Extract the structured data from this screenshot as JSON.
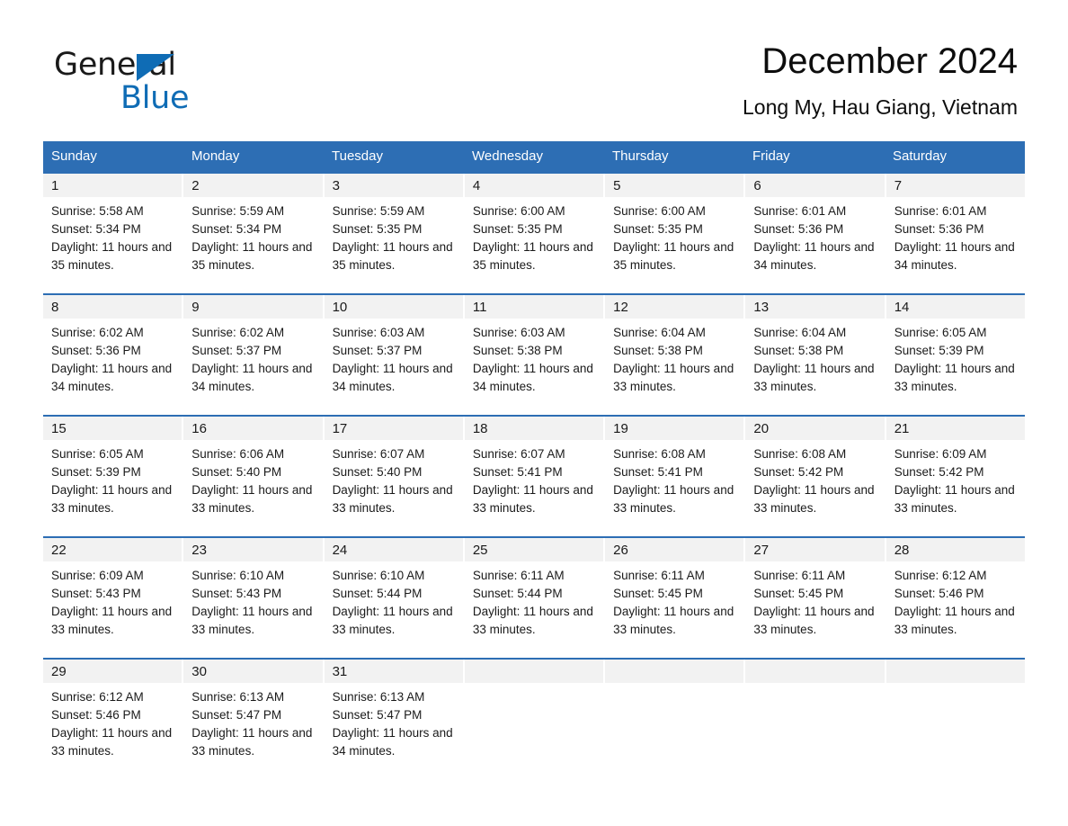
{
  "logo": {
    "word1": "General",
    "word2": "Blue",
    "triangle_color": "#0f6cb5"
  },
  "header": {
    "title": "December 2024",
    "subtitle": "Long My, Hau Giang, Vietnam"
  },
  "theme": {
    "header_blue": "#2d6eb4",
    "daynum_band": "#f2f2f2",
    "text": "#1a1a1a"
  },
  "calendar": {
    "weekday_headers": [
      "Sunday",
      "Monday",
      "Tuesday",
      "Wednesday",
      "Thursday",
      "Friday",
      "Saturday"
    ],
    "weeks": [
      [
        {
          "day": "1",
          "sunrise": "Sunrise: 5:58 AM",
          "sunset": "Sunset: 5:34 PM",
          "daylight": "Daylight: 11 hours and 35 minutes."
        },
        {
          "day": "2",
          "sunrise": "Sunrise: 5:59 AM",
          "sunset": "Sunset: 5:34 PM",
          "daylight": "Daylight: 11 hours and 35 minutes."
        },
        {
          "day": "3",
          "sunrise": "Sunrise: 5:59 AM",
          "sunset": "Sunset: 5:35 PM",
          "daylight": "Daylight: 11 hours and 35 minutes."
        },
        {
          "day": "4",
          "sunrise": "Sunrise: 6:00 AM",
          "sunset": "Sunset: 5:35 PM",
          "daylight": "Daylight: 11 hours and 35 minutes."
        },
        {
          "day": "5",
          "sunrise": "Sunrise: 6:00 AM",
          "sunset": "Sunset: 5:35 PM",
          "daylight": "Daylight: 11 hours and 35 minutes."
        },
        {
          "day": "6",
          "sunrise": "Sunrise: 6:01 AM",
          "sunset": "Sunset: 5:36 PM",
          "daylight": "Daylight: 11 hours and 34 minutes."
        },
        {
          "day": "7",
          "sunrise": "Sunrise: 6:01 AM",
          "sunset": "Sunset: 5:36 PM",
          "daylight": "Daylight: 11 hours and 34 minutes."
        }
      ],
      [
        {
          "day": "8",
          "sunrise": "Sunrise: 6:02 AM",
          "sunset": "Sunset: 5:36 PM",
          "daylight": "Daylight: 11 hours and 34 minutes."
        },
        {
          "day": "9",
          "sunrise": "Sunrise: 6:02 AM",
          "sunset": "Sunset: 5:37 PM",
          "daylight": "Daylight: 11 hours and 34 minutes."
        },
        {
          "day": "10",
          "sunrise": "Sunrise: 6:03 AM",
          "sunset": "Sunset: 5:37 PM",
          "daylight": "Daylight: 11 hours and 34 minutes."
        },
        {
          "day": "11",
          "sunrise": "Sunrise: 6:03 AM",
          "sunset": "Sunset: 5:38 PM",
          "daylight": "Daylight: 11 hours and 34 minutes."
        },
        {
          "day": "12",
          "sunrise": "Sunrise: 6:04 AM",
          "sunset": "Sunset: 5:38 PM",
          "daylight": "Daylight: 11 hours and 33 minutes."
        },
        {
          "day": "13",
          "sunrise": "Sunrise: 6:04 AM",
          "sunset": "Sunset: 5:38 PM",
          "daylight": "Daylight: 11 hours and 33 minutes."
        },
        {
          "day": "14",
          "sunrise": "Sunrise: 6:05 AM",
          "sunset": "Sunset: 5:39 PM",
          "daylight": "Daylight: 11 hours and 33 minutes."
        }
      ],
      [
        {
          "day": "15",
          "sunrise": "Sunrise: 6:05 AM",
          "sunset": "Sunset: 5:39 PM",
          "daylight": "Daylight: 11 hours and 33 minutes."
        },
        {
          "day": "16",
          "sunrise": "Sunrise: 6:06 AM",
          "sunset": "Sunset: 5:40 PM",
          "daylight": "Daylight: 11 hours and 33 minutes."
        },
        {
          "day": "17",
          "sunrise": "Sunrise: 6:07 AM",
          "sunset": "Sunset: 5:40 PM",
          "daylight": "Daylight: 11 hours and 33 minutes."
        },
        {
          "day": "18",
          "sunrise": "Sunrise: 6:07 AM",
          "sunset": "Sunset: 5:41 PM",
          "daylight": "Daylight: 11 hours and 33 minutes."
        },
        {
          "day": "19",
          "sunrise": "Sunrise: 6:08 AM",
          "sunset": "Sunset: 5:41 PM",
          "daylight": "Daylight: 11 hours and 33 minutes."
        },
        {
          "day": "20",
          "sunrise": "Sunrise: 6:08 AM",
          "sunset": "Sunset: 5:42 PM",
          "daylight": "Daylight: 11 hours and 33 minutes."
        },
        {
          "day": "21",
          "sunrise": "Sunrise: 6:09 AM",
          "sunset": "Sunset: 5:42 PM",
          "daylight": "Daylight: 11 hours and 33 minutes."
        }
      ],
      [
        {
          "day": "22",
          "sunrise": "Sunrise: 6:09 AM",
          "sunset": "Sunset: 5:43 PM",
          "daylight": "Daylight: 11 hours and 33 minutes."
        },
        {
          "day": "23",
          "sunrise": "Sunrise: 6:10 AM",
          "sunset": "Sunset: 5:43 PM",
          "daylight": "Daylight: 11 hours and 33 minutes."
        },
        {
          "day": "24",
          "sunrise": "Sunrise: 6:10 AM",
          "sunset": "Sunset: 5:44 PM",
          "daylight": "Daylight: 11 hours and 33 minutes."
        },
        {
          "day": "25",
          "sunrise": "Sunrise: 6:11 AM",
          "sunset": "Sunset: 5:44 PM",
          "daylight": "Daylight: 11 hours and 33 minutes."
        },
        {
          "day": "26",
          "sunrise": "Sunrise: 6:11 AM",
          "sunset": "Sunset: 5:45 PM",
          "daylight": "Daylight: 11 hours and 33 minutes."
        },
        {
          "day": "27",
          "sunrise": "Sunrise: 6:11 AM",
          "sunset": "Sunset: 5:45 PM",
          "daylight": "Daylight: 11 hours and 33 minutes."
        },
        {
          "day": "28",
          "sunrise": "Sunrise: 6:12 AM",
          "sunset": "Sunset: 5:46 PM",
          "daylight": "Daylight: 11 hours and 33 minutes."
        }
      ],
      [
        {
          "day": "29",
          "sunrise": "Sunrise: 6:12 AM",
          "sunset": "Sunset: 5:46 PM",
          "daylight": "Daylight: 11 hours and 33 minutes."
        },
        {
          "day": "30",
          "sunrise": "Sunrise: 6:13 AM",
          "sunset": "Sunset: 5:47 PM",
          "daylight": "Daylight: 11 hours and 33 minutes."
        },
        {
          "day": "31",
          "sunrise": "Sunrise: 6:13 AM",
          "sunset": "Sunset: 5:47 PM",
          "daylight": "Daylight: 11 hours and 34 minutes."
        },
        {
          "day": "",
          "sunrise": "",
          "sunset": "",
          "daylight": ""
        },
        {
          "day": "",
          "sunrise": "",
          "sunset": "",
          "daylight": ""
        },
        {
          "day": "",
          "sunrise": "",
          "sunset": "",
          "daylight": ""
        },
        {
          "day": "",
          "sunrise": "",
          "sunset": "",
          "daylight": ""
        }
      ]
    ]
  }
}
